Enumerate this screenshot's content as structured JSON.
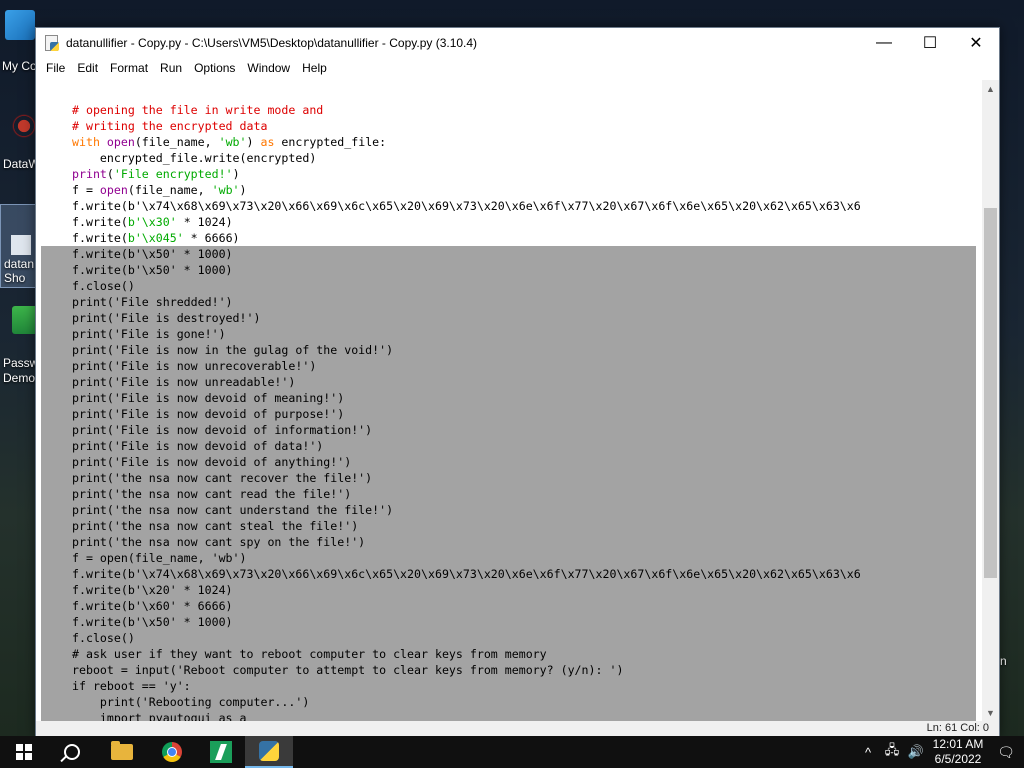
{
  "desktop": {
    "icons": [
      {
        "label": "My Co",
        "name": "my-computer"
      },
      {
        "label": "DataW",
        "name": "datawiper"
      },
      {
        "label": "datan\nSho",
        "name": "datanullifier-shortcut"
      },
      {
        "label": "Passw\nDemo",
        "name": "password-demo"
      }
    ],
    "right_edge_text": "n"
  },
  "window": {
    "title": "datanullifier - Copy.py - C:\\Users\\VM5\\Desktop\\datanullifier - Copy.py (3.10.4)",
    "controls": {
      "minimize": "—",
      "maximize": "☐",
      "close": "✕"
    },
    "menu": [
      "File",
      "Edit",
      "Format",
      "Run",
      "Options",
      "Window",
      "Help"
    ],
    "status": "Ln: 61 Col: 0"
  },
  "code_lines": [
    {
      "text": "# opening the file in write mode and",
      "selected": false
    },
    {
      "text": "# writing the encrypted data",
      "selected": false
    },
    {
      "text": "with open(file_name, 'wb') as encrypted_file:",
      "selected": false
    },
    {
      "text": "    encrypted_file.write(encrypted)",
      "selected": false
    },
    {
      "text": "print('File encrypted!')",
      "selected": false
    },
    {
      "text": "f = open(file_name, 'wb')",
      "selected": false
    },
    {
      "text": "f.write(b'\\x74\\x68\\x69\\x73\\x20\\x66\\x69\\x6c\\x65\\x20\\x69\\x73\\x20\\x6e\\x6f\\x77\\x20\\x67\\x6f\\x6e\\x65\\x20\\x62\\x65\\x63\\x6",
      "selected": false
    },
    {
      "text": "f.write(b'\\x30' * 1024)",
      "selected": false
    },
    {
      "text": "f.write(b'\\x045' * 6666)",
      "selected": false
    },
    {
      "text": "f.write(b'\\x50' * 1000)",
      "selected": true
    },
    {
      "text": "f.write(b'\\x50' * 1000)",
      "selected": true
    },
    {
      "text": "f.close()",
      "selected": true
    },
    {
      "text": "print('File shredded!')",
      "selected": true
    },
    {
      "text": "print('File is destroyed!')",
      "selected": true
    },
    {
      "text": "print('File is gone!')",
      "selected": true
    },
    {
      "text": "print('File is now in the gulag of the void!')",
      "selected": true
    },
    {
      "text": "print('File is now unrecoverable!')",
      "selected": true
    },
    {
      "text": "print('File is now unreadable!')",
      "selected": true
    },
    {
      "text": "print('File is now devoid of meaning!')",
      "selected": true
    },
    {
      "text": "print('File is now devoid of purpose!')",
      "selected": true
    },
    {
      "text": "print('File is now devoid of information!')",
      "selected": true
    },
    {
      "text": "print('File is now devoid of data!')",
      "selected": true
    },
    {
      "text": "print('File is now devoid of anything!')",
      "selected": true
    },
    {
      "text": "print('the nsa now cant recover the file!')",
      "selected": true
    },
    {
      "text": "print('the nsa now cant read the file!')",
      "selected": true
    },
    {
      "text": "print('the nsa now cant understand the file!')",
      "selected": true
    },
    {
      "text": "print('the nsa now cant steal the file!')",
      "selected": true
    },
    {
      "text": "print('the nsa now cant spy on the file!')",
      "selected": true
    },
    {
      "text": "f = open(file_name, 'wb')",
      "selected": true
    },
    {
      "text": "f.write(b'\\x74\\x68\\x69\\x73\\x20\\x66\\x69\\x6c\\x65\\x20\\x69\\x73\\x20\\x6e\\x6f\\x77\\x20\\x67\\x6f\\x6e\\x65\\x20\\x62\\x65\\x63\\x6",
      "selected": true
    },
    {
      "text": "f.write(b'\\x20' * 1024)",
      "selected": true
    },
    {
      "text": "f.write(b'\\x60' * 6666)",
      "selected": true
    },
    {
      "text": "f.write(b'\\x50' * 1000)",
      "selected": true
    },
    {
      "text": "f.close()",
      "selected": true
    },
    {
      "text": "# ask user if they want to reboot computer to clear keys from memory",
      "selected": true
    },
    {
      "text": "reboot = input('Reboot computer to attempt to clear keys from memory? (y/n): ')",
      "selected": true
    },
    {
      "text": "if reboot == 'y':",
      "selected": true
    },
    {
      "text": "    print('Rebooting computer...')",
      "selected": true
    },
    {
      "text": "    import pyautogui as a",
      "selected": true
    }
  ],
  "taskbar": {
    "apps": [
      "start-button",
      "search-button",
      "file-explorer",
      "chrome",
      "datawiper-app",
      "python-idle"
    ],
    "tray": {
      "chevron": "^",
      "time": "12:01 AM",
      "date": "6/5/2022"
    }
  },
  "colors": {
    "keyword": "#ff7700",
    "builtin": "#900090",
    "string": "#00aa00",
    "comment": "#dd0000",
    "selection": "#a3a3a3"
  }
}
